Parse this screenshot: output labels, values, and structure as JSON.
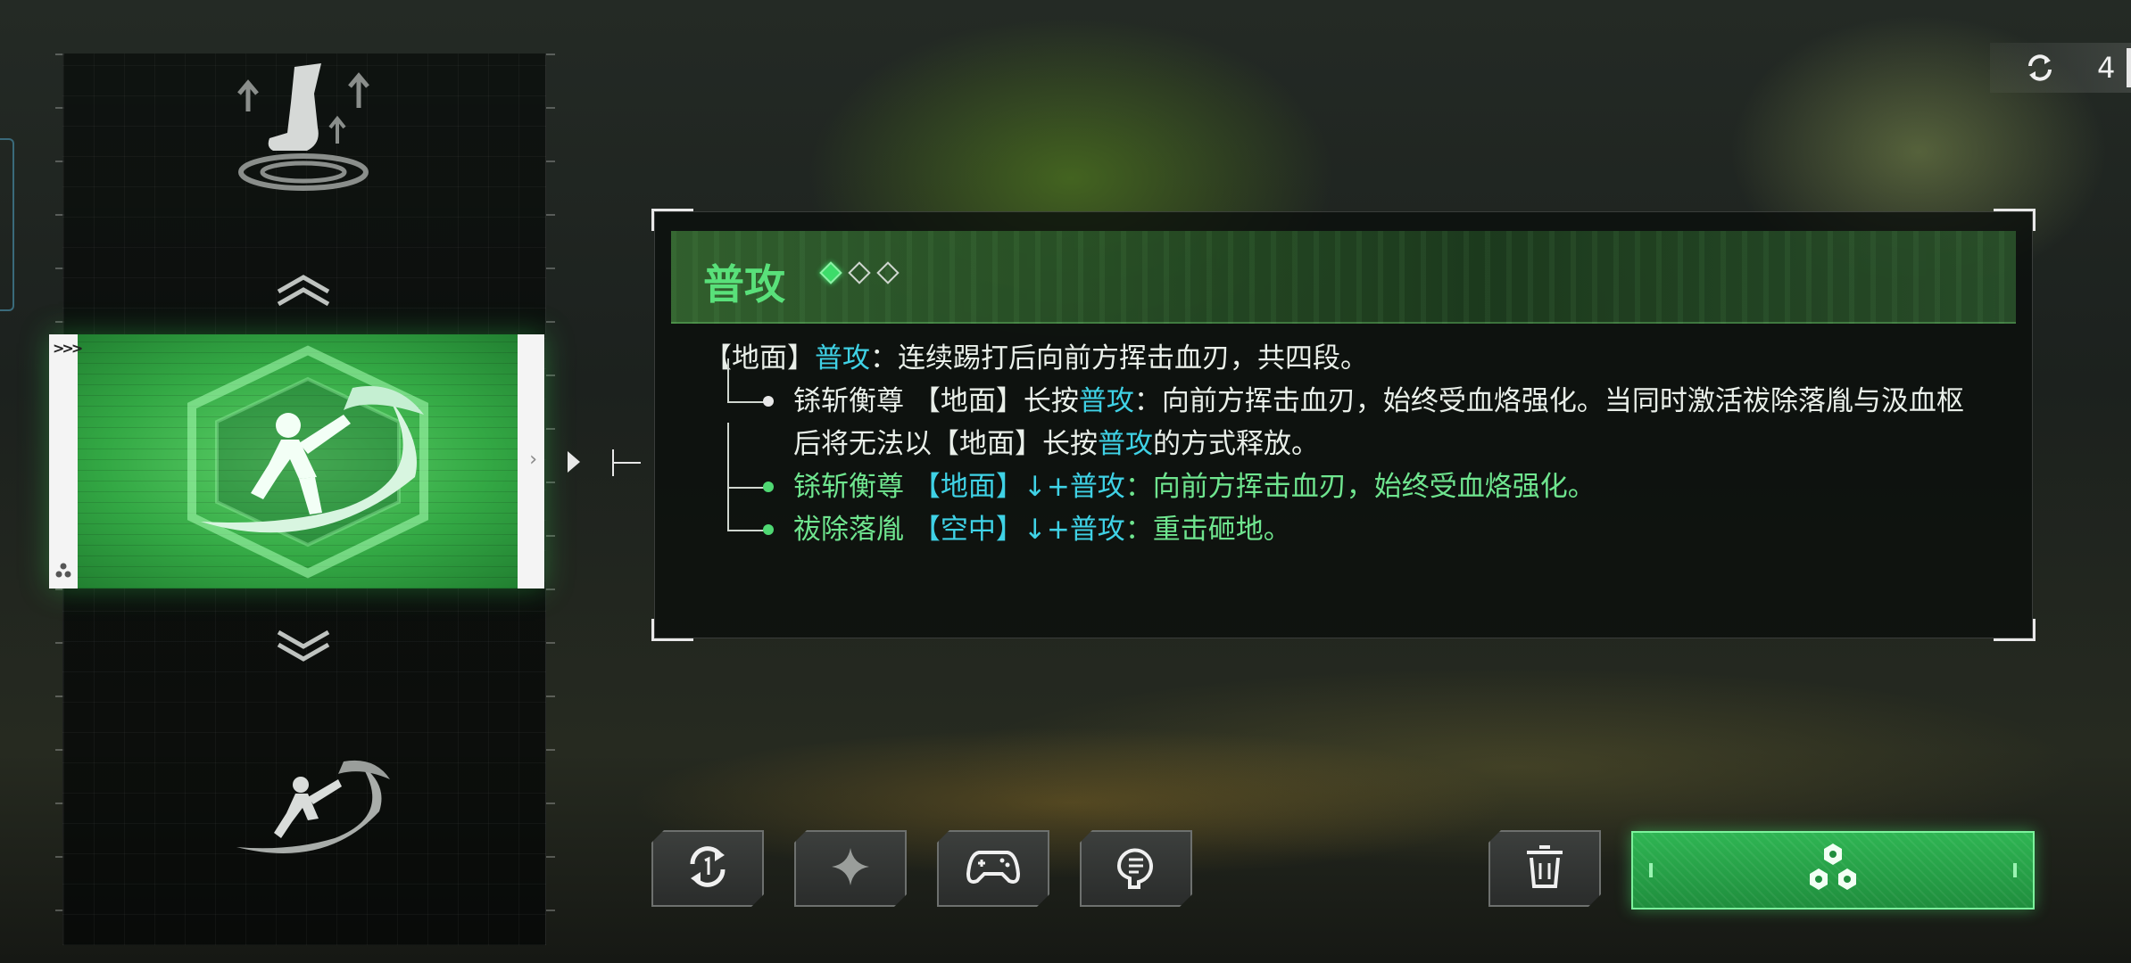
{
  "counter": {
    "value": "4",
    "icon": "refresh-icon"
  },
  "skill_panel": {
    "title": "普攻",
    "rank": {
      "total": 3,
      "active": 1
    },
    "main_line": {
      "prefix": "【地面】",
      "skill": "普攻",
      "text": "：连续踢打后向前方挥击血刃，共四段。"
    },
    "branches": [
      {
        "style": "white",
        "name": "铩斩衡尊",
        "pre": " 【地面】长按",
        "skill": "普攻",
        "post": "：向前方挥击血刃，始终受血烙强化。当同时激活祓除落胤与汲血枢后将无法以【地面】长按",
        "skill2": "普攻",
        "post2": "的方式释放。"
      },
      {
        "style": "green",
        "name": "铩斩衡尊",
        "pre": " 【地面】↓+",
        "skill": "普攻",
        "post": "：向前方挥击血刃，始终受血烙强化。"
      },
      {
        "style": "green",
        "name": "祓除落胤",
        "pre": " 【空中】↓+",
        "skill": "普攻",
        "post": "：重击砸地。"
      }
    ]
  },
  "skill_column": {
    "items": [
      {
        "icon": "dodge-kick-icon",
        "selected": false
      },
      {
        "icon": "blade-slash-icon",
        "selected": true
      },
      {
        "icon": "blade-slash-icon",
        "selected": false
      }
    ],
    "selected_badge": ">>>"
  },
  "toolbar": {
    "buttons": [
      "reset-icon",
      "sparkle-icon",
      "gamepad-icon",
      "help-icon",
      "trash-icon"
    ],
    "confirm_icon": "hexagon-cluster-icon"
  },
  "colors": {
    "accent_green": "#3ddc6a",
    "highlight_cyan": "#3fd2e6",
    "text_green": "#6fe58f"
  }
}
